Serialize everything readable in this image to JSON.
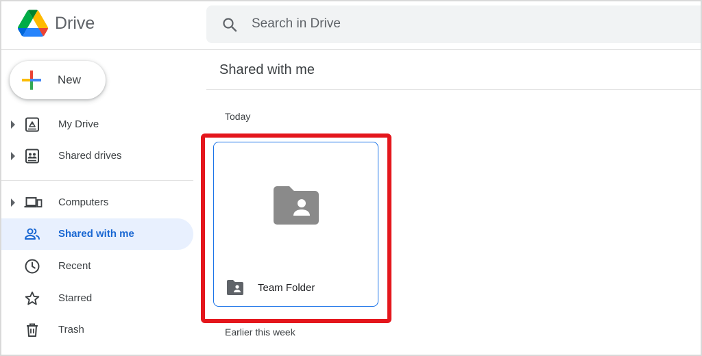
{
  "header": {
    "app_title": "Drive",
    "logo_icon": "google-drive-logo",
    "search_placeholder": "Search in Drive"
  },
  "sidebar": {
    "new_label": "New",
    "items": [
      {
        "label": "My Drive",
        "icon": "my-drive-icon",
        "expandable": true,
        "active": false
      },
      {
        "label": "Shared drives",
        "icon": "shared-drives-icon",
        "expandable": true,
        "active": false
      },
      {
        "label": "Computers",
        "icon": "computers-icon",
        "expandable": true,
        "active": false
      },
      {
        "label": "Shared with me",
        "icon": "people-icon",
        "expandable": false,
        "active": true
      },
      {
        "label": "Recent",
        "icon": "clock-icon",
        "expandable": false,
        "active": false
      },
      {
        "label": "Starred",
        "icon": "star-icon",
        "expandable": false,
        "active": false
      },
      {
        "label": "Trash",
        "icon": "trash-icon",
        "expandable": false,
        "active": false
      }
    ]
  },
  "main": {
    "title": "Shared with me",
    "sections": [
      {
        "label": "Today",
        "items": [
          {
            "name": "Team Folder",
            "type": "shared-folder"
          }
        ]
      },
      {
        "label": "Earlier this week",
        "items": []
      }
    ]
  },
  "colors": {
    "accent": "#1a73e8",
    "active_bg": "#e8f0fe",
    "active_text": "#1967d2",
    "highlight": "#e4161c",
    "icon_gray": "#5f6368"
  }
}
